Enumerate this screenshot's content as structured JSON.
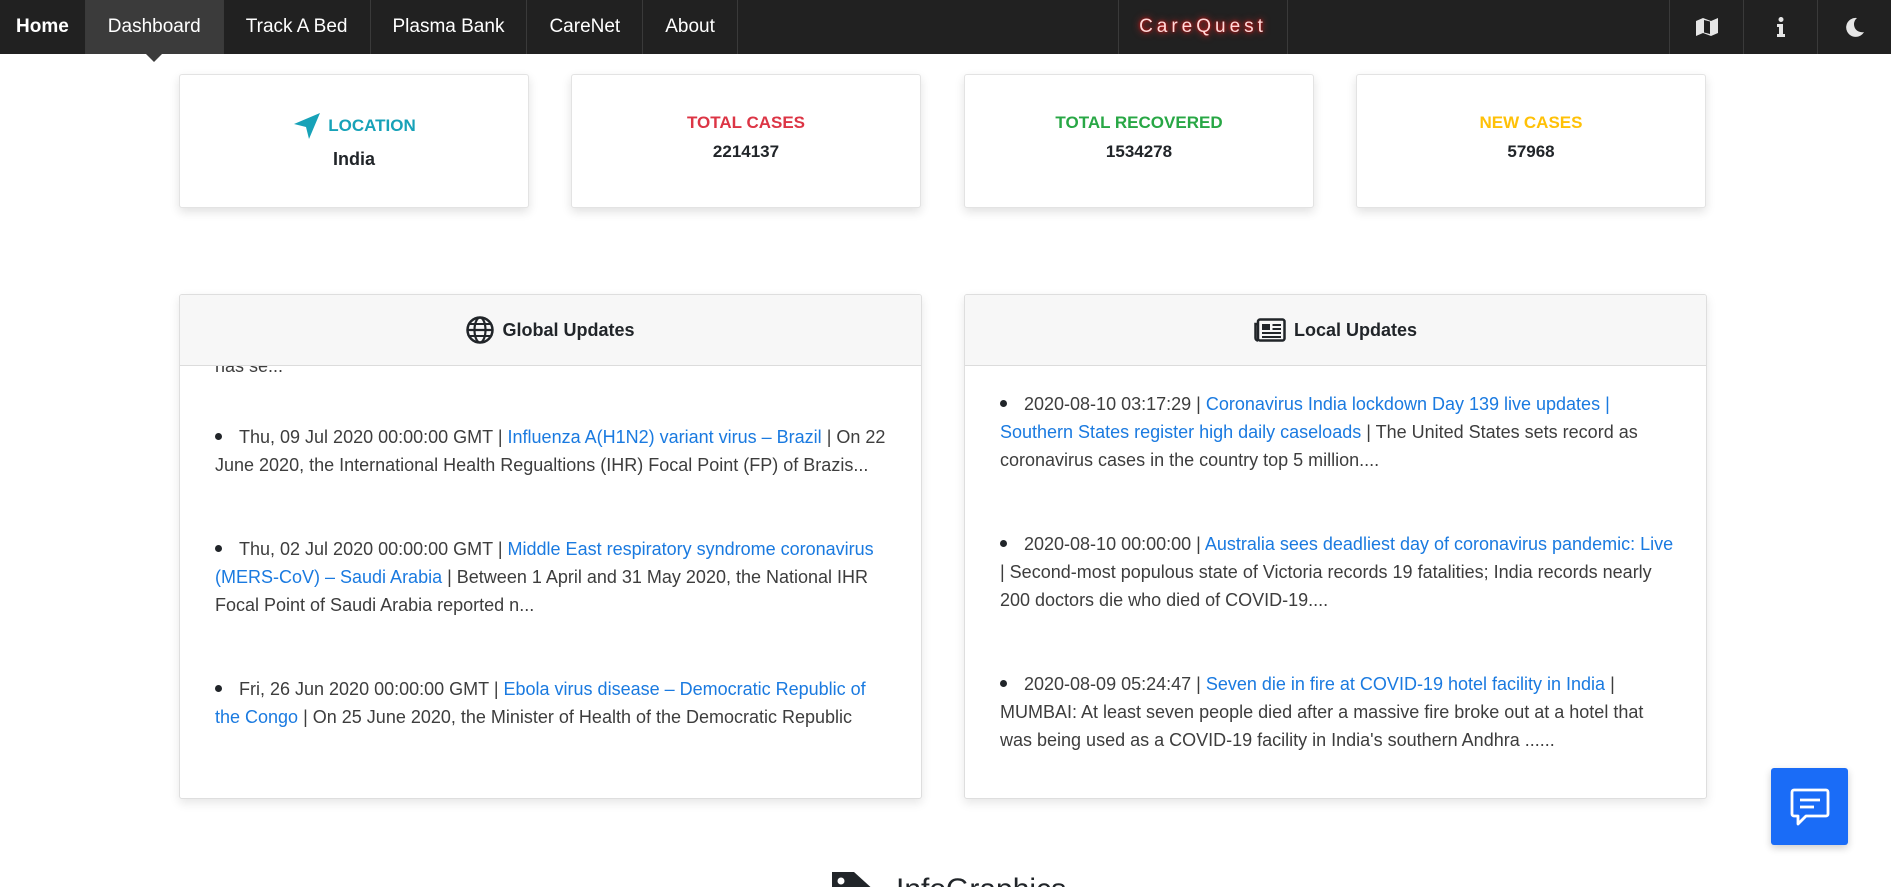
{
  "nav": {
    "items": [
      {
        "label": "Home"
      },
      {
        "label": "Dashboard"
      },
      {
        "label": "Track A Bed"
      },
      {
        "label": "Plasma Bank"
      },
      {
        "label": "CareNet"
      },
      {
        "label": "About"
      }
    ],
    "active_index": 1,
    "brand_title": "CareQuest",
    "right_icons": [
      "map-icon",
      "info-icon",
      "moon-icon"
    ]
  },
  "stats": {
    "location": {
      "label": "LOCATION",
      "value": "India",
      "color": "#17a2b8"
    },
    "total_cases": {
      "label": "TOTAL CASES",
      "value": "2214137",
      "color": "#dc3545"
    },
    "total_recovered": {
      "label": "TOTAL RECOVERED",
      "value": "1534278",
      "color": "#28a745"
    },
    "new_cases": {
      "label": "NEW CASES",
      "value": "57968",
      "color": "#ffc107"
    }
  },
  "global_updates": {
    "title": "Global Updates",
    "partial_top": "has se...",
    "items": [
      {
        "date": "Thu, 09 Jul 2020 00:00:00 GMT |",
        "link": "Influenza A(H1N2) variant virus – Brazil",
        "text": "| On 22 June 2020, the International Health Regualtions (IHR) Focal Point (FP) of Brazis..."
      },
      {
        "date": "Thu, 02 Jul 2020 00:00:00 GMT |",
        "link": "Middle East respiratory syndrome coronavirus (MERS-CoV) – Saudi Arabia",
        "text": "| Between 1 April and 31 May 2020, the National IHR Focal Point of Saudi Arabia reported n..."
      },
      {
        "date": "Fri, 26 Jun 2020 00:00:00 GMT |",
        "link": "Ebola virus disease – Democratic Republic of the Congo",
        "text": "| On 25 June 2020, the Minister of Health of the Democratic Republic"
      }
    ]
  },
  "local_updates": {
    "title": "Local Updates",
    "items": [
      {
        "date": "2020-08-10 03:17:29 |",
        "link": "Coronavirus India lockdown Day 139 live updates | Southern States register high daily caseloads",
        "text": "| The United States sets record as coronavirus cases in the country top 5 million...."
      },
      {
        "date": "2020-08-10 00:00:00 |",
        "link": "Australia sees deadliest day of coronavirus pandemic: Live",
        "text": "| Second-most populous state of Victoria records 19 fatalities; India records nearly 200 doctors die who died of COVID-19...."
      },
      {
        "date": "2020-08-09 05:24:47 |",
        "link": "Seven die in fire at COVID-19 hotel facility in India",
        "text": "| MUMBAI: At least seven people died after a massive fire broke out at a hotel that was being used as a COVID-19 facility in India's southern Andhra ......"
      }
    ]
  },
  "infographics": {
    "title": "InfoGraphics"
  },
  "chat": {
    "icon": "chat-icon"
  }
}
